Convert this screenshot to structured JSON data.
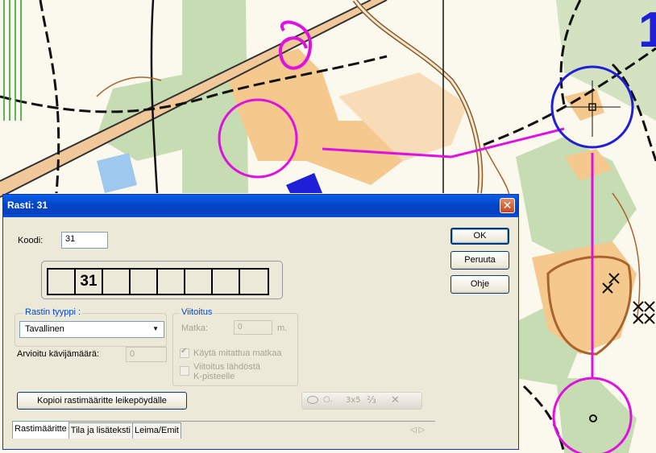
{
  "map": {
    "number_label": "1"
  },
  "dialog": {
    "title": "Rasti: 31",
    "close_symbol": "✕",
    "koodi_label": "Koodi:",
    "koodi_value": "31",
    "code_cells": [
      "",
      "31",
      "",
      "",
      "",
      "",
      "",
      "",
      ""
    ],
    "type_group_title": "Rastin tyyppi :",
    "type_value": "Tavallinen",
    "arvioitu_label": "Arvioitu kävijämäärä:",
    "arvioitu_value": "0",
    "viitoitus": {
      "title": "Viitoitus",
      "matka_label": "Matka:",
      "matka_value": "0",
      "matka_unit": "m.",
      "kayta_label": "Käytä mitattua matkaa",
      "kayta_checked": true,
      "lahdosta_label_1": "Viitoitus lähdöstä",
      "lahdosta_label_2": "K-pisteelle",
      "lahdosta_checked": false
    },
    "buttons": {
      "ok": "OK",
      "cancel": "Peruuta",
      "help": "Ohje",
      "copy": "Kopioi rastimääritte leikepöydälle"
    },
    "toolbar": {
      "a": "3x5",
      "b": "⅔",
      "c": "✕"
    },
    "tabs": [
      "Rastimääritte",
      "Tila ja lisäteksti",
      "Leima/Emit"
    ],
    "tab_arrows": "◁ ▷"
  },
  "colors": {
    "title_bar": "#0a52d8",
    "dialog_bg": "#ece9d8",
    "course_magenta": "#e010e0",
    "map_blue": "#1f1fd8"
  }
}
